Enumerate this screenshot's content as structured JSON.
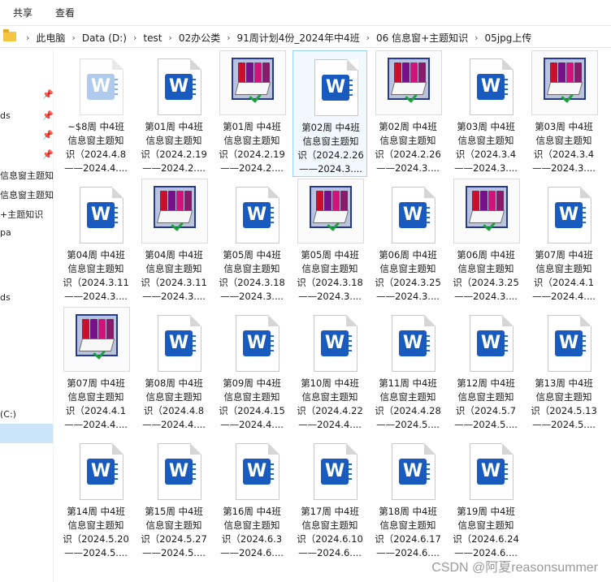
{
  "ribbon": {
    "tabs": [
      "共享",
      "查看"
    ]
  },
  "address": {
    "crumbs": [
      "此电脑",
      "Data (D:)",
      "test",
      "02办公类",
      "91周计划4份_2024年中4班",
      "06 信息窗+主题知识",
      "05jpg上传"
    ]
  },
  "sidebar": {
    "items": [
      "ds",
      "信息窗主题知",
      "信息窗主题知",
      "+主题知识",
      "pa",
      "ds",
      "(C:)"
    ]
  },
  "files": [
    {
      "type": "word-faded",
      "l1": "~$8周 中4班",
      "l2": "信息窗主题知",
      "l3": "识（2024.4.8",
      "l4": "——2024.4...."
    },
    {
      "type": "word",
      "l1": "第01周 中4班",
      "l2": "信息窗主题知",
      "l3": "识（2024.2.19",
      "l4": "——2024.2...."
    },
    {
      "type": "image",
      "l1": "第01周 中4班",
      "l2": "信息窗主题知",
      "l3": "识（2024.2.19",
      "l4": "——2024.2...."
    },
    {
      "type": "word",
      "l1": "第02周 中4班",
      "l2": "信息窗主题知",
      "l3": "识（2024.2.26",
      "l4": "——2024.3...."
    },
    {
      "type": "image",
      "l1": "第02周 中4班",
      "l2": "信息窗主题知",
      "l3": "识（2024.2.26",
      "l4": "——2024.3...."
    },
    {
      "type": "word",
      "l1": "第03周 中4班",
      "l2": "信息窗主题知",
      "l3": "识（2024.3.4",
      "l4": "——2024.3...."
    },
    {
      "type": "image",
      "l1": "第03周 中4班",
      "l2": "信息窗主题知",
      "l3": "识（2024.3.4",
      "l4": "——2024.3...."
    },
    {
      "type": "word",
      "l1": "第04周 中4班",
      "l2": "信息窗主题知",
      "l3": "识（2024.3.11",
      "l4": "——2024.3...."
    },
    {
      "type": "image",
      "l1": "第04周 中4班",
      "l2": "信息窗主题知",
      "l3": "识（2024.3.11",
      "l4": "——2024.3...."
    },
    {
      "type": "word",
      "l1": "第05周 中4班",
      "l2": "信息窗主题知",
      "l3": "识（2024.3.18",
      "l4": "——2024.3...."
    },
    {
      "type": "image",
      "l1": "第05周 中4班",
      "l2": "信息窗主题知",
      "l3": "识（2024.3.18",
      "l4": "——2024.3...."
    },
    {
      "type": "word",
      "l1": "第06周 中4班",
      "l2": "信息窗主题知",
      "l3": "识（2024.3.25",
      "l4": "——2024.3...."
    },
    {
      "type": "image",
      "l1": "第06周 中4班",
      "l2": "信息窗主题知",
      "l3": "识（2024.3.25",
      "l4": "——2024.3...."
    },
    {
      "type": "word",
      "l1": "第07周 中4班",
      "l2": "信息窗主题知",
      "l3": "识（2024.4.1",
      "l4": "——2024.4...."
    },
    {
      "type": "image",
      "l1": "第07周 中4班",
      "l2": "信息窗主题知",
      "l3": "识（2024.4.1",
      "l4": "——2024.4...."
    },
    {
      "type": "word",
      "l1": "第08周 中4班",
      "l2": "信息窗主题知",
      "l3": "识（2024.4.8",
      "l4": "——2024.4...."
    },
    {
      "type": "word",
      "l1": "第09周 中4班",
      "l2": "信息窗主题知",
      "l3": "识（2024.4.15",
      "l4": "——2024.4...."
    },
    {
      "type": "word",
      "l1": "第10周 中4班",
      "l2": "信息窗主题知",
      "l3": "识（2024.4.22",
      "l4": "——2024.4...."
    },
    {
      "type": "word",
      "l1": "第11周 中4班",
      "l2": "信息窗主题知",
      "l3": "识（2024.4.28",
      "l4": "——2024.5...."
    },
    {
      "type": "word",
      "l1": "第12周 中4班",
      "l2": "信息窗主题知",
      "l3": "识（2024.5.7",
      "l4": "——2024.5...."
    },
    {
      "type": "word",
      "l1": "第13周 中4班",
      "l2": "信息窗主题知",
      "l3": "识（2024.5.13",
      "l4": "——2024.5...."
    },
    {
      "type": "word",
      "l1": "第14周 中4班",
      "l2": "信息窗主题知",
      "l3": "识（2024.5.20",
      "l4": "——2024.5...."
    },
    {
      "type": "word",
      "l1": "第15周 中4班",
      "l2": "信息窗主题知",
      "l3": "识（2024.5.27",
      "l4": "——2024.5...."
    },
    {
      "type": "word",
      "l1": "第16周 中4班",
      "l2": "信息窗主题知",
      "l3": "识（2024.6.3",
      "l4": "——2024.6...."
    },
    {
      "type": "word",
      "l1": "第17周 中4班",
      "l2": "信息窗主题知",
      "l3": "识（2024.6.10",
      "l4": "——2024.6...."
    },
    {
      "type": "word",
      "l1": "第18周 中4班",
      "l2": "信息窗主题知",
      "l3": "识（2024.6.17",
      "l4": "——2024.6...."
    },
    {
      "type": "word",
      "l1": "第19周 中4班",
      "l2": "信息窗主题知",
      "l3": "识（2024.6.24",
      "l4": "——2024.6...."
    }
  ],
  "watermark": "CSDN @阿夏reasonsummer"
}
